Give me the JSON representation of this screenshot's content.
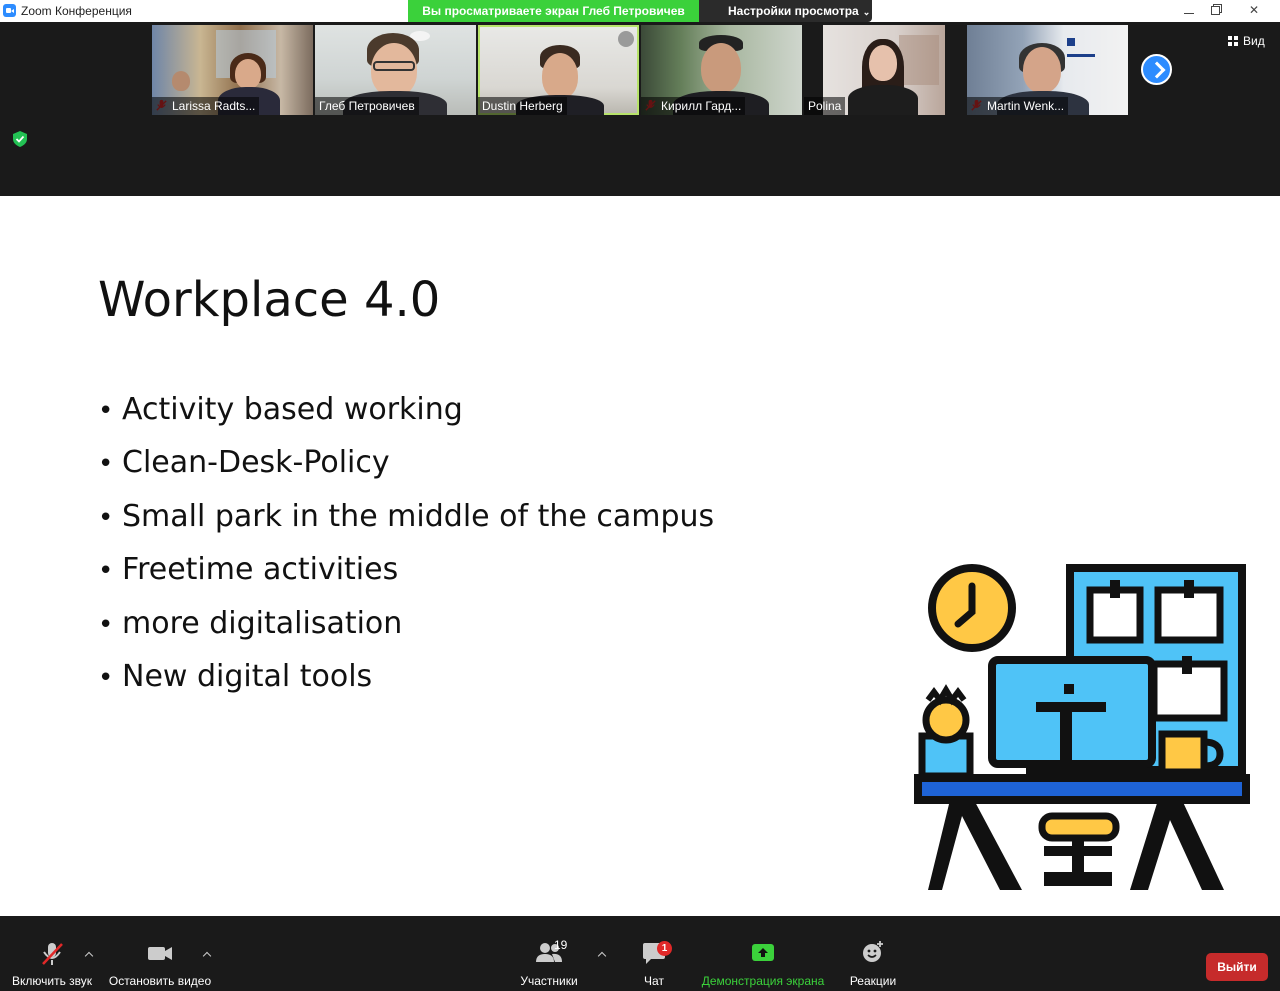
{
  "window": {
    "title": "Zoom Конференция",
    "share_banner": "Вы просматриваете экран Глеб Петровичев",
    "view_options": "Настройки просмотра"
  },
  "gallery": {
    "view_label": "Вид",
    "participants": [
      {
        "name": "Larissa Radts...",
        "muted": true,
        "speaking": false
      },
      {
        "name": "Глеб Петровичев",
        "muted": false,
        "speaking": false
      },
      {
        "name": "Dustin Herberg",
        "muted": false,
        "speaking": true
      },
      {
        "name": "Кирилл Гард...",
        "muted": true,
        "speaking": false
      },
      {
        "name": "Polina",
        "muted": false,
        "speaking": false
      },
      {
        "name": "Martin Wenk...",
        "muted": true,
        "speaking": false
      }
    ]
  },
  "slide": {
    "title": "Workplace 4.0",
    "bullets": [
      "Activity based working",
      "Clean-Desk-Policy",
      "Small park in the middle of the campus",
      "Freetime activities",
      "more digitalisation",
      "New digital tools"
    ]
  },
  "toolbar": {
    "unmute": "Включить звук",
    "stop_video": "Остановить видео",
    "participants": "Участники",
    "participants_count": "19",
    "chat": "Чат",
    "chat_badge": "1",
    "share_screen": "Демонстрация экрана",
    "reactions": "Реакции",
    "leave": "Выйти"
  },
  "colors": {
    "zoom_blue": "#2d8cff",
    "share_green": "#3bd13b",
    "leave_red": "#c62b2b",
    "illustration_blue": "#4fc3f7",
    "illustration_yellow": "#ffc845"
  }
}
